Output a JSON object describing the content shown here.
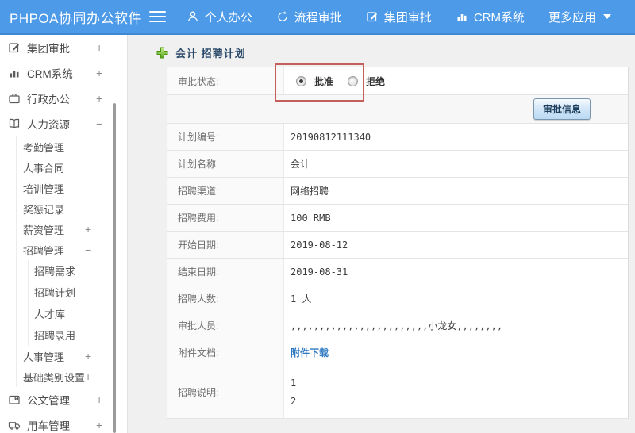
{
  "colors": {
    "navbar": "#4d9ae8",
    "annotation": "#c4605c",
    "link": "#2e79c0",
    "title": "#2b4a6a",
    "plus_green": "#56a516"
  },
  "navbar": {
    "logo": "PHPOA协同办公软件",
    "items": [
      {
        "label": "个人办公",
        "icon": "user-icon"
      },
      {
        "label": "流程审批",
        "icon": "flow-icon"
      },
      {
        "label": "集团审批",
        "icon": "edit-icon"
      },
      {
        "label": "CRM系统",
        "icon": "chart-icon"
      },
      {
        "label": "更多应用",
        "icon": "caret-down-icon"
      }
    ]
  },
  "sidebar": {
    "items": [
      {
        "label": "集团审批",
        "icon": "edit-square-icon",
        "expand": "+",
        "level": 0
      },
      {
        "label": "CRM系统",
        "icon": "bar-chart-icon",
        "expand": "+",
        "level": 0
      },
      {
        "label": "行政办公",
        "icon": "briefcase-icon",
        "expand": "+",
        "level": 0
      },
      {
        "label": "人力资源",
        "icon": "book-icon",
        "expand": "−",
        "level": 0
      },
      {
        "label": "考勤管理",
        "level": 1
      },
      {
        "label": "人事合同",
        "level": 1
      },
      {
        "label": "培训管理",
        "level": 1
      },
      {
        "label": "奖惩记录",
        "level": 1
      },
      {
        "label": "薪资管理",
        "expand": "+",
        "level": 1
      },
      {
        "label": "招聘管理",
        "expand": "−",
        "level": 1
      },
      {
        "label": "招聘需求",
        "level": 2
      },
      {
        "label": "招聘计划",
        "level": 2
      },
      {
        "label": "人才库",
        "level": 2
      },
      {
        "label": "招聘录用",
        "level": 2
      },
      {
        "label": "人事管理",
        "expand": "+",
        "level": 1
      },
      {
        "label": "基础类别设置",
        "expand": "+",
        "level": 1
      },
      {
        "label": "公文管理",
        "icon": "document-icon",
        "expand": "+",
        "level": 0
      },
      {
        "label": "用车管理",
        "icon": "truck-icon",
        "expand": "+",
        "level": 0
      }
    ]
  },
  "main": {
    "title": "会计 招聘计划",
    "approval": {
      "label": "审批状态:",
      "options": [
        {
          "label": "批准",
          "checked": true
        },
        {
          "label": "拒绝",
          "checked": false
        }
      ]
    },
    "approve_button": "审批信息",
    "rows": [
      {
        "label": "计划编号:",
        "value": "20190812111340"
      },
      {
        "label": "计划名称:",
        "value": "会计"
      },
      {
        "label": "招聘渠道:",
        "value": "网络招聘"
      },
      {
        "label": "招聘费用:",
        "value": "100 RMB"
      },
      {
        "label": "开始日期:",
        "value": "2019-08-12"
      },
      {
        "label": "结束日期:",
        "value": "2019-08-31"
      },
      {
        "label": "招聘人数:",
        "value": "1 人"
      },
      {
        "label": "审批人员:",
        "value": ",,,,,,,,,,,,,,,,,,,,,,,,小龙女,,,,,,,,"
      },
      {
        "label": "附件文档:",
        "value": "附件下载"
      },
      {
        "label": "招聘说明:",
        "lines": [
          "1",
          "2"
        ]
      }
    ]
  }
}
